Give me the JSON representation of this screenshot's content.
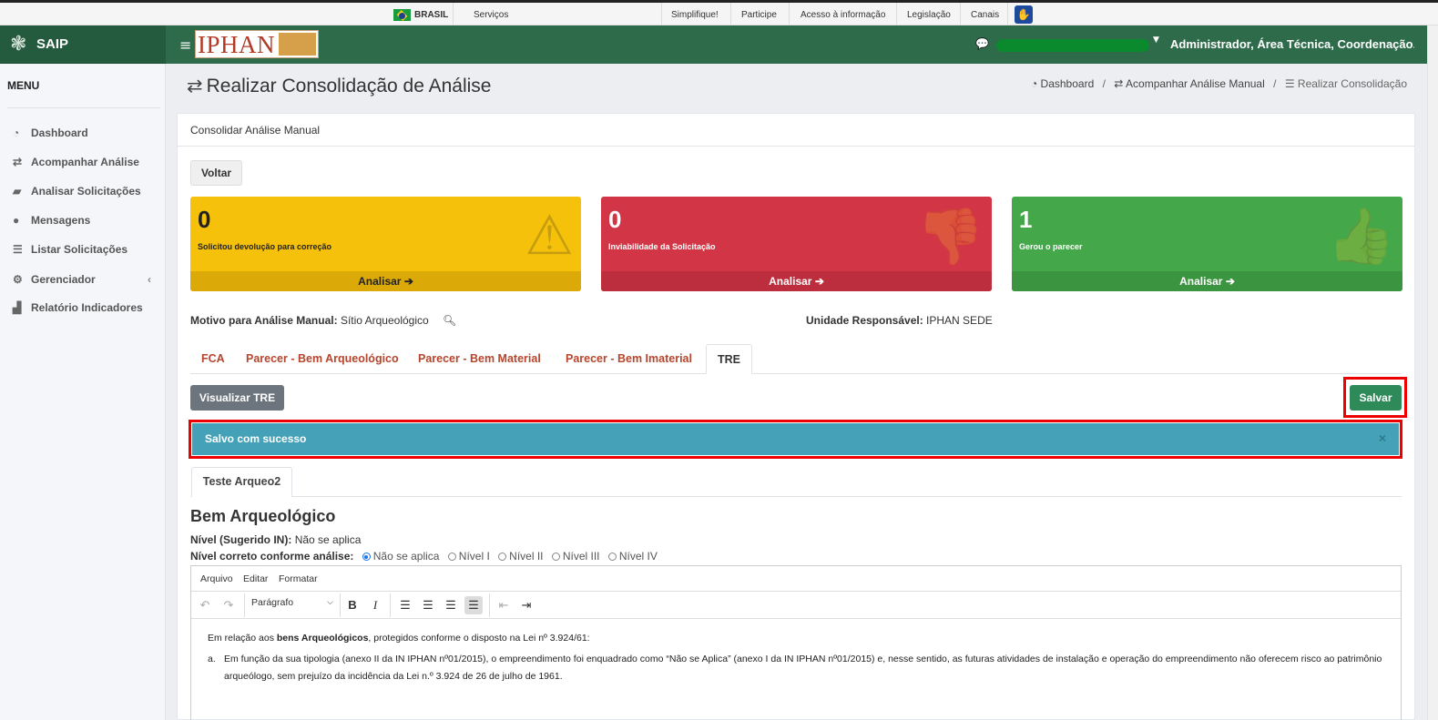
{
  "govbar": {
    "country": "BRASIL",
    "links": [
      "Serviços",
      "Simplifique!",
      "Participe",
      "Acesso à informação",
      "Legislação",
      "Canais"
    ],
    "vlibras_icon": "hand-icon"
  },
  "header": {
    "app_name": "SAIP",
    "logo_text": "IPHAN",
    "user_label": "Administrador, Área Técnica, Coordenação..."
  },
  "sidebar": {
    "menu_title": "MENU",
    "items": [
      {
        "label": "Dashboard",
        "icon": "tachometer-icon"
      },
      {
        "label": "Acompanhar Análise",
        "icon": "exchange-icon"
      },
      {
        "label": "Analisar Solicitações",
        "icon": "book-icon"
      },
      {
        "label": "Mensagens",
        "icon": "comments-icon"
      },
      {
        "label": "Listar Solicitações",
        "icon": "list-icon"
      },
      {
        "label": "Gerenciador",
        "icon": "cogs-icon"
      },
      {
        "label": "Relatório Indicadores",
        "icon": "area-chart-icon"
      }
    ]
  },
  "page": {
    "title": "Realizar Consolidação de Análise",
    "breadcrumb": [
      "Dashboard",
      "Acompanhar Análise Manual",
      "Realizar Consolidação"
    ]
  },
  "card": {
    "header": "Consolidar Análise Manual",
    "back_label": "Voltar"
  },
  "boxes": [
    {
      "count": "0",
      "label": "Solicitou devolução para correção",
      "footer": "Analisar",
      "color": "#f6c10a",
      "icon": "warning-icon"
    },
    {
      "count": "0",
      "label": "Inviabilidade da Solicitação",
      "footer": "Analisar",
      "color": "#d23646",
      "icon": "thumbs-down-icon"
    },
    {
      "count": "1",
      "label": "Gerou o parecer",
      "footer": "Analisar",
      "color": "#44a74a",
      "icon": "thumbs-up-icon"
    }
  ],
  "info": {
    "motivo_label": "Motivo para Análise Manual:",
    "motivo_value": "Sítio Arqueológico",
    "unidade_label": "Unidade Responsável:",
    "unidade_value": "IPHAN SEDE"
  },
  "tabs": [
    "FCA",
    "Parecer - Bem Arqueológico",
    "Parecer - Bem Material",
    "Parecer - Bem Imaterial",
    "TRE"
  ],
  "active_tab": "TRE",
  "actions": {
    "view_label": "Visualizar TRE",
    "save_label": "Salvar"
  },
  "alert": {
    "message": "Salvo com sucesso",
    "close": "×"
  },
  "subtab": "Teste Arqueo2",
  "bem": {
    "title": "Bem Arqueológico",
    "nivel_sugerido_label": "Nível (Sugerido IN):",
    "nivel_sugerido_value": "Não se aplica",
    "nivel_correto_label": "Nível correto conforme análise:",
    "options": [
      "Não se aplica",
      "Nível I",
      "Nível II",
      "Nível III",
      "Nível IV"
    ],
    "selected": "Não se aplica"
  },
  "editor": {
    "menus": [
      "Arquivo",
      "Editar",
      "Formatar"
    ],
    "block_format": "Parágrafo",
    "para1_pre": "Em relação aos ",
    "para1_bold": "bens Arqueológicos",
    "para1_post": ", protegidos conforme o disposto na Lei nº 3.924/61:",
    "item_marker": "a.",
    "item_text": "Em função da sua tipologia (anexo II da IN IPHAN nº01/2015), o empreendimento foi enquadrado como “Não se Aplica” (anexo I da IN IPHAN nº01/2015) e, nesse sentido, as futuras atividades de instalação e operação do empreendimento não oferecem risco ao patrimônio arqueólogo, sem prejuízo da incidência da Lei n.º 3.924 de 26 de julho de 1961."
  }
}
